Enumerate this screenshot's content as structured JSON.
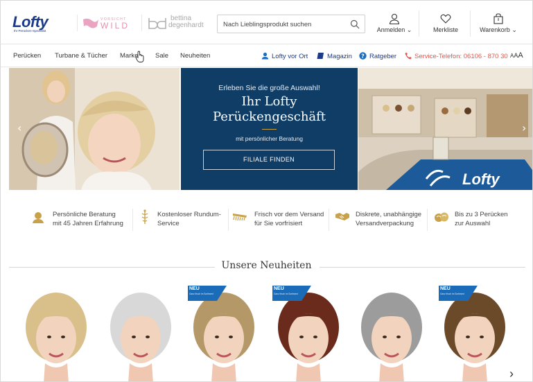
{
  "header": {
    "logo": {
      "word": "Lofty",
      "tagline": "Ihr Perücken-Spezialist"
    },
    "brand_vorsicht": {
      "top": "VORSICHT",
      "bottom": "WILD"
    },
    "brand_bettina": {
      "line1": "bettina",
      "line2": "degenhardt"
    },
    "search": {
      "placeholder": "Nach Lieblingsprodukt suchen"
    },
    "login_label": "Anmelden",
    "wishlist_label": "Merkliste",
    "cart_label": "Warenkorb"
  },
  "nav": {
    "items": [
      "Perücken",
      "Turbane & Tücher",
      "Marken",
      "Sale",
      "Neuheiten"
    ],
    "util": {
      "store": "Lofty vor Ort",
      "magazine": "Magazin",
      "guide": "Ratgeber",
      "phone": "Service-Telefon: 06106 - 870 30",
      "font_size": "AAA"
    }
  },
  "hero": {
    "kicker": "Erleben Sie die große Auswahl!",
    "title_line1": "Ihr Lofty",
    "title_line2": "Perückengeschäft",
    "subtitle": "mit persönlicher Beratung",
    "button": "FILIALE FINDEN",
    "store_sign": "Lofty"
  },
  "usps": [
    {
      "l1": "Persönliche Beratung",
      "l2": "mit 45 Jahren Erfahrung",
      "icon": "consultant-icon"
    },
    {
      "l1": "Kostenloser Rundum-",
      "l2": "Service",
      "icon": "caduceus-icon"
    },
    {
      "l1": "Frisch vor dem Versand",
      "l2": "für Sie vorfrisiert",
      "icon": "comb-icon"
    },
    {
      "l1": "Diskrete, unabhängige",
      "l2": "Versandverpackung",
      "icon": "handshake-icon"
    },
    {
      "l1": "Bis zu 3 Perücken",
      "l2": "zur Auswahl",
      "icon": "wigs-icon"
    }
  ],
  "section": {
    "title": "Unsere Neuheiten"
  },
  "products": [
    {
      "hair": "#d9c08a",
      "neu": false
    },
    {
      "hair": "#d8d8d8",
      "neu": false
    },
    {
      "hair": "#b49867",
      "neu": true
    },
    {
      "hair": "#6a2b1c",
      "neu": true
    },
    {
      "hair": "#9c9c9c",
      "neu": false
    },
    {
      "hair": "#6b4a2a",
      "neu": true
    }
  ],
  "neu_badge": {
    "label": "NEU",
    "sub": "Ganz frisch im Sortiment"
  },
  "colors": {
    "brand": "#1c3a8a",
    "hero_panel": "#0f3d66",
    "gold": "#c9a14a",
    "phone": "#e2554a",
    "neu_blue": "#1b6cb8"
  }
}
